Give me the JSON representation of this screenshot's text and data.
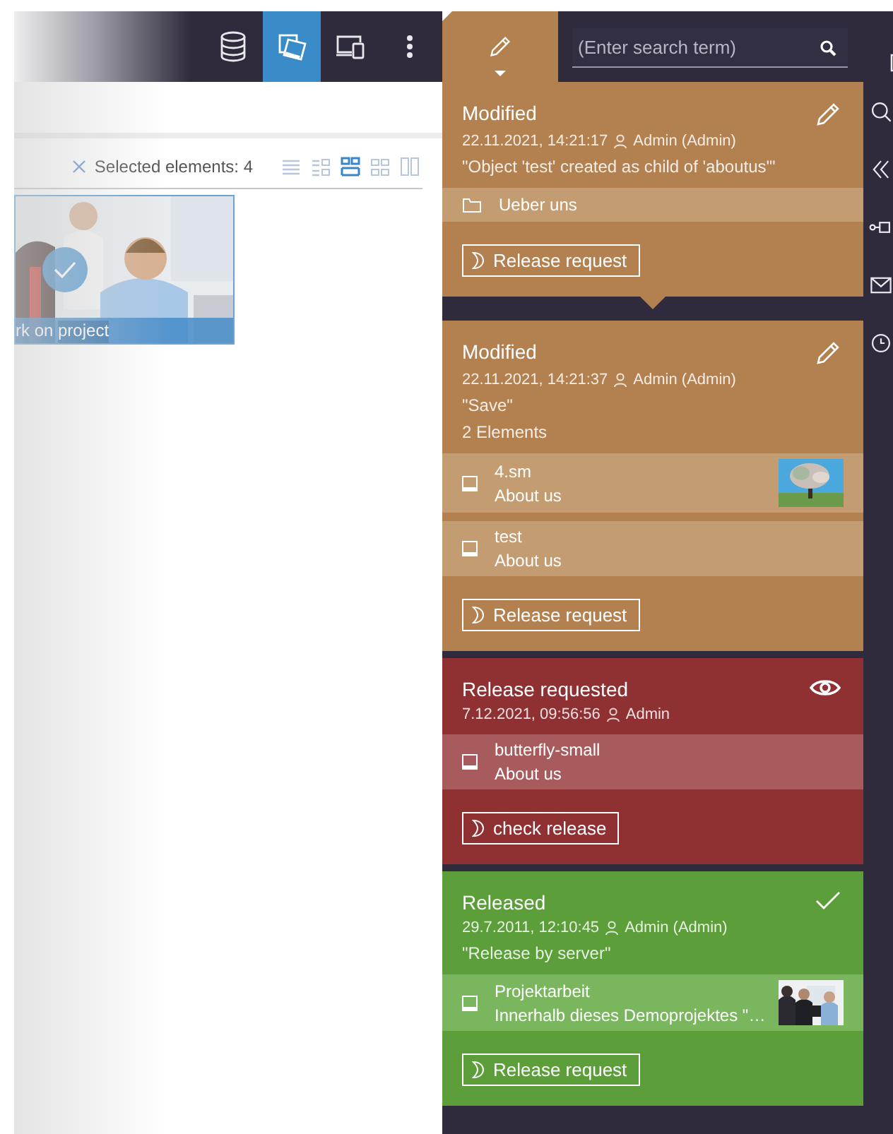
{
  "toolbar": {
    "buttons": [
      {
        "kind": "database",
        "selected": false
      },
      {
        "kind": "photos",
        "selected": true
      },
      {
        "kind": "devices",
        "selected": false
      },
      {
        "kind": "more",
        "selected": false
      }
    ]
  },
  "search": {
    "placeholder": "(Enter search term)"
  },
  "selection": {
    "label": "Selected elements: 4"
  },
  "view_modes": [
    {
      "kind": "list",
      "selected": false
    },
    {
      "kind": "details",
      "selected": false
    },
    {
      "kind": "large-tiles",
      "selected": true
    },
    {
      "kind": "tiles",
      "selected": false
    },
    {
      "kind": "columns",
      "selected": false
    }
  ],
  "tile": {
    "caption": "rk on project",
    "checked": true
  },
  "cards": [
    {
      "kind": "modified",
      "selected": true,
      "title": "Modified",
      "timestamp": "22.11.2021, 14:21:17",
      "user": "Admin (Admin)",
      "comment": "\"Object 'test' created as child of 'aboutus'\"",
      "items": [
        {
          "kind": "folder",
          "name": "Ueber uns",
          "has_thumbnail": false
        }
      ],
      "action": "Release request"
    },
    {
      "kind": "modified",
      "selected": false,
      "title": "Modified",
      "timestamp": "22.11.2021, 14:21:37",
      "user": "Admin (Admin)",
      "comment": "\"Save\"",
      "count": "2 Elements",
      "items": [
        {
          "kind": "page",
          "name": "4.sm",
          "parent": "About us",
          "has_thumbnail": true
        },
        {
          "kind": "page",
          "name": "test",
          "parent": "About us",
          "has_thumbnail": false
        }
      ],
      "action": "Release request"
    },
    {
      "kind": "release_requested",
      "selected": false,
      "title": "Release requested",
      "timestamp": "7.12.2021, 09:56:56",
      "user": "Admin",
      "items": [
        {
          "kind": "page",
          "name": "butterfly-small",
          "parent": "About us",
          "has_thumbnail": false
        }
      ],
      "action": "check release"
    },
    {
      "kind": "released",
      "selected": false,
      "title": "Released",
      "timestamp": "29.7.2011, 12:10:45",
      "user": "Admin (Admin)",
      "comment": "\"Release by server\"",
      "items": [
        {
          "kind": "page",
          "name": "Projektarbeit",
          "parent": "Innerhalb dieses Demoprojektes \"…",
          "has_thumbnail": true
        }
      ],
      "action": "Release request"
    }
  ],
  "rail": [
    {
      "kind": "chat"
    },
    {
      "kind": "search"
    },
    {
      "kind": "collapse"
    },
    {
      "kind": "connector"
    },
    {
      "kind": "mail"
    },
    {
      "kind": "clock"
    }
  ]
}
